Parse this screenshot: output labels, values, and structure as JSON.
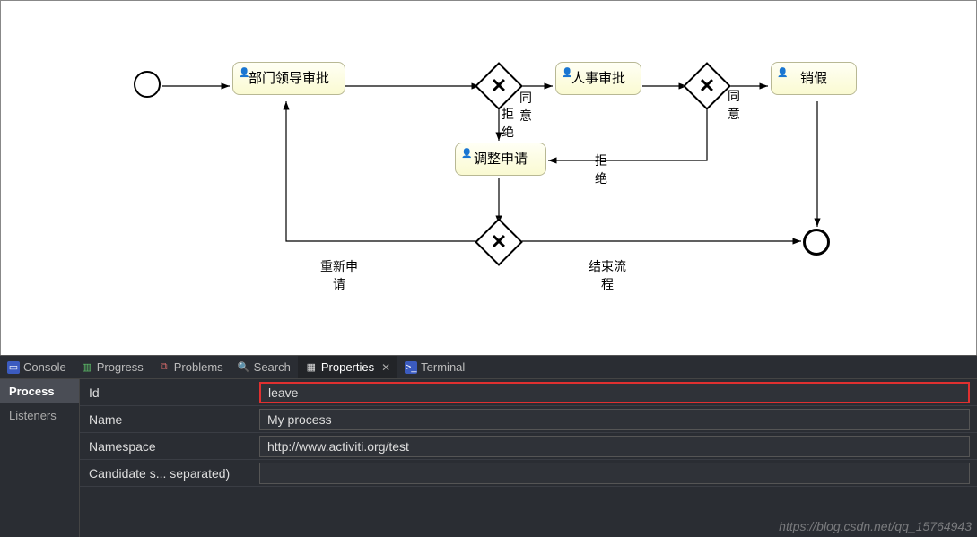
{
  "diagram": {
    "task1": "部门领导审批",
    "task2": "人事审批",
    "task3": "销假",
    "task4": "调整申请",
    "labels": {
      "agree1": "同\n意",
      "reject1": "拒\n绝",
      "agree2": "同\n意",
      "reject2": "拒\n绝",
      "reapply": "重新申\n请",
      "endflow": "结束流\n程"
    }
  },
  "tabs": {
    "console": "Console",
    "progress": "Progress",
    "problems": "Problems",
    "search": "Search",
    "properties": "Properties",
    "terminal": "Terminal"
  },
  "propnav": {
    "process": "Process",
    "listeners": "Listeners"
  },
  "props": {
    "id": {
      "label": "Id",
      "value": "leave"
    },
    "name": {
      "label": "Name",
      "value": "My process"
    },
    "namespace": {
      "label": "Namespace",
      "value": "http://www.activiti.org/test"
    },
    "candidate": {
      "label": "Candidate s... separated)",
      "value": ""
    }
  },
  "watermark": "https://blog.csdn.net/qq_15764943"
}
